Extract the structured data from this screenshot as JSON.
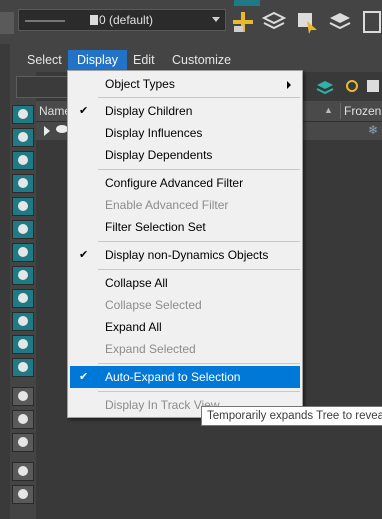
{
  "toolbar": {
    "layer_label": "0 (default)"
  },
  "menubar": {
    "items": [
      "Select",
      "Display",
      "Edit",
      "Customize"
    ]
  },
  "explorer": {
    "name_header": "Name",
    "frozen_header": "Frozen",
    "sort_arrow": "▲",
    "frozen_icon": "❄"
  },
  "display_menu": {
    "items": [
      {
        "label": "Object Types",
        "checked": false,
        "enabled": true,
        "submenu": true
      },
      {
        "label": "Display Children",
        "checked": true,
        "enabled": true
      },
      {
        "label": "Display Influences",
        "checked": false,
        "enabled": true
      },
      {
        "label": "Display Dependents",
        "checked": false,
        "enabled": true
      },
      {
        "label": "Configure Advanced Filter",
        "checked": false,
        "enabled": true
      },
      {
        "label": "Enable Advanced Filter",
        "checked": false,
        "enabled": false
      },
      {
        "label": "Filter Selection Set",
        "checked": false,
        "enabled": true
      },
      {
        "label": "Display non-Dynamics Objects",
        "checked": true,
        "enabled": true
      },
      {
        "label": "Collapse All",
        "checked": false,
        "enabled": true
      },
      {
        "label": "Collapse Selected",
        "checked": false,
        "enabled": false
      },
      {
        "label": "Expand All",
        "checked": false,
        "enabled": true
      },
      {
        "label": "Expand Selected",
        "checked": false,
        "enabled": false
      },
      {
        "label": "Auto-Expand to Selection",
        "checked": true,
        "enabled": true,
        "highlighted": true
      },
      {
        "label": "Display In Track View",
        "checked": false,
        "enabled": false
      }
    ],
    "check_glyph": "✔"
  },
  "tooltip": {
    "text": "Temporarily expands Tree to revea"
  },
  "colors": {
    "accent": "#1f7a86",
    "menu_highlight": "#0078d7",
    "menubar_active": "#2273c6"
  }
}
